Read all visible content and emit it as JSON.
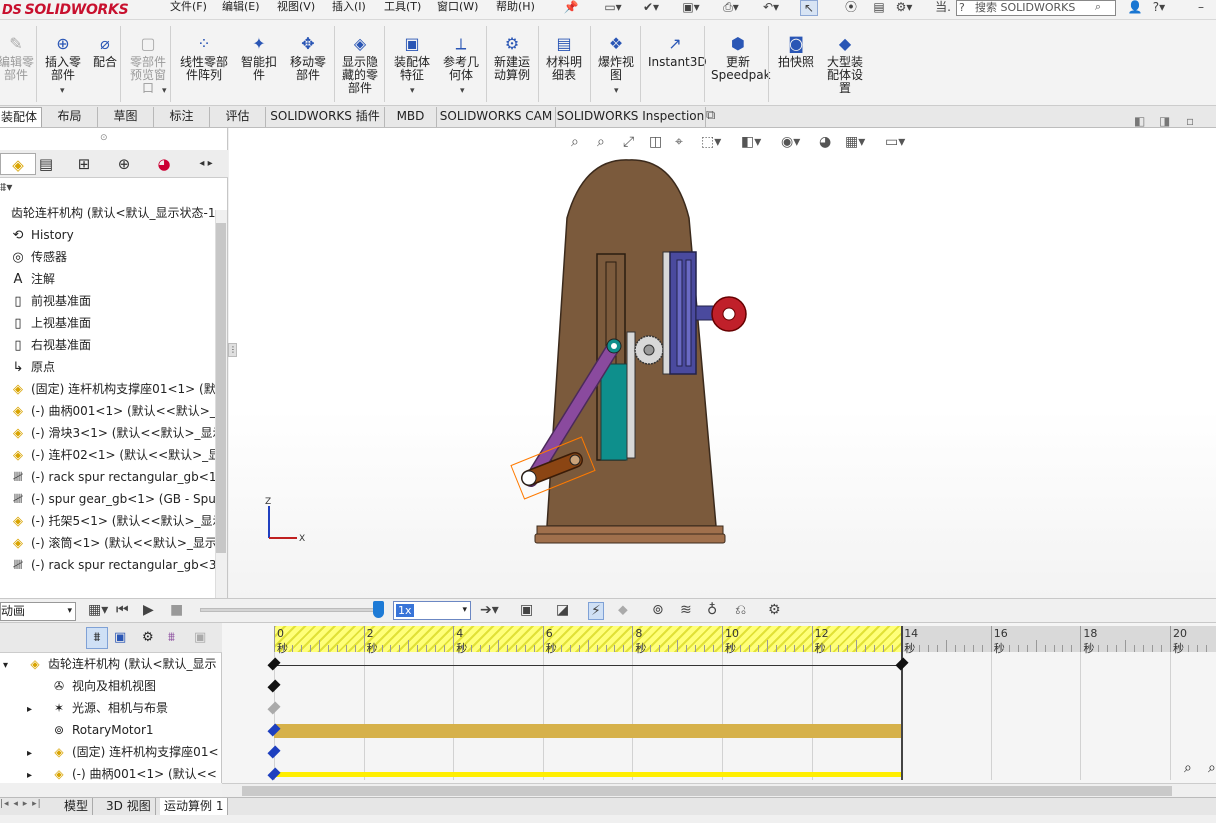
{
  "titlebar": {
    "logo_ds": "DS",
    "logo_text": "SOLIDWORKS",
    "menus": [
      "文件(F)",
      "编辑(E)",
      "视图(V)",
      "插入(I)",
      "工具(T)",
      "窗口(W)",
      "帮助(H)"
    ],
    "search_placeholder": "搜索 SOLIDWORKS",
    "short_label": "当."
  },
  "ribbon": {
    "buttons": [
      {
        "label": "编辑零\n部件",
        "icon": "edit-part-icon",
        "dim": true
      },
      {
        "label": "插入零\n部件",
        "icon": "insert-component-icon"
      },
      {
        "label": "配合",
        "icon": "mate-icon"
      },
      {
        "label": "零部件\n预览窗\n口",
        "icon": "preview-window-icon",
        "dim": true
      },
      {
        "label": "线性零部\n件阵列",
        "icon": "linear-pattern-icon"
      },
      {
        "label": "智能扣\n件",
        "icon": "smart-fastener-icon"
      },
      {
        "label": "移动零\n部件",
        "icon": "move-component-icon"
      },
      {
        "label": "显示隐\n藏的零\n部件",
        "icon": "show-hidden-icon"
      },
      {
        "label": "装配体\n特征",
        "icon": "assembly-feature-icon"
      },
      {
        "label": "参考几\n何体",
        "icon": "reference-geometry-icon"
      },
      {
        "label": "新建运\n动算例",
        "icon": "new-motion-study-icon"
      },
      {
        "label": "材料明\n细表",
        "icon": "bom-icon"
      },
      {
        "label": "爆炸视\n图",
        "icon": "exploded-view-icon"
      },
      {
        "label": "Instant3D",
        "icon": "instant3d-icon"
      },
      {
        "label": "更新\nSpeedpak",
        "icon": "speedpak-icon"
      },
      {
        "label": "拍快照",
        "icon": "snapshot-icon"
      },
      {
        "label": "大型装\n配体设\n置",
        "icon": "large-assembly-icon"
      }
    ]
  },
  "command_tabs": [
    "装配体",
    "布局",
    "草图",
    "标注",
    "评估",
    "SOLIDWORKS 插件",
    "MBD",
    "SOLIDWORKS CAM",
    "SOLIDWORKS Inspection"
  ],
  "feature_tree": {
    "root": "齿轮连杆机构 (默认<默认_显示状态-1",
    "items": [
      {
        "label": "History",
        "icon": "history-icon"
      },
      {
        "label": "传感器",
        "icon": "sensor-icon"
      },
      {
        "label": "注解",
        "icon": "annotation-icon"
      },
      {
        "label": "前视基准面",
        "icon": "plane-icon"
      },
      {
        "label": "上视基准面",
        "icon": "plane-icon"
      },
      {
        "label": "右视基准面",
        "icon": "plane-icon"
      },
      {
        "label": "原点",
        "icon": "origin-icon"
      },
      {
        "label": "(固定) 连杆机构支撑座01<1> (默",
        "icon": "assembly-icon"
      },
      {
        "label": "(-) 曲柄001<1> (默认<<默认>_显",
        "icon": "assembly-icon"
      },
      {
        "label": "(-) 滑块3<1> (默认<<默认>_显示",
        "icon": "assembly-icon"
      },
      {
        "label": "(-) 连杆02<1> (默认<<默认>_显",
        "icon": "assembly-icon"
      },
      {
        "label": "(-) rack spur rectangular_gb<1",
        "icon": "part-icon"
      },
      {
        "label": "(-) spur gear_gb<1> (GB - Spu",
        "icon": "part-icon"
      },
      {
        "label": "(-) 托架5<1> (默认<<默认>_显示",
        "icon": "assembly-icon"
      },
      {
        "label": "(-) 滚筒<1> (默认<<默认>_显示",
        "icon": "assembly-icon"
      },
      {
        "label": "(-) rack spur rectangular_gb<3",
        "icon": "part-icon"
      }
    ]
  },
  "motion": {
    "study_type": "动画",
    "playback_speed": "1x",
    "slider_fraction": 0.95,
    "tree": [
      {
        "label": "齿轮连杆机构 (默认<默认_显示",
        "icon": "assembly-icon",
        "expand": "▾",
        "indent": 0
      },
      {
        "label": "视向及相机视图",
        "icon": "camera-icon",
        "expand": "",
        "indent": 1
      },
      {
        "label": "光源、相机与布景",
        "icon": "lights-icon",
        "expand": "▸",
        "indent": 1
      },
      {
        "label": "RotaryMotor1",
        "icon": "motor-icon",
        "expand": "",
        "indent": 1
      },
      {
        "label": "(固定) 连杆机构支撑座01<",
        "icon": "assembly-icon",
        "expand": "▸",
        "indent": 1
      },
      {
        "label": "(-) 曲柄001<1> (默认<<",
        "icon": "assembly-icon",
        "expand": "▸",
        "indent": 1
      }
    ],
    "ticks": [
      "0 秒",
      "2 秒",
      "4 秒",
      "6 秒",
      "8 秒",
      "10 秒",
      "12 秒",
      "14 秒",
      "16 秒",
      "18 秒",
      "20 秒"
    ],
    "duration_seconds": 14
  },
  "bottom_tabs": [
    "模型",
    "3D 视图",
    "运动算例 1"
  ],
  "colors": {
    "body": "#7b5a3c",
    "base": "#a0704c",
    "crank_link": "#8a4a9e",
    "crank": "#8b4513",
    "slider": "#0e8f8c",
    "bracket": "#4a4a9e",
    "roller": "#c0202a",
    "timeline_bar": "#d6b14a",
    "timeline_bar2": "#ffee00",
    "key": "#1d3fbf"
  }
}
